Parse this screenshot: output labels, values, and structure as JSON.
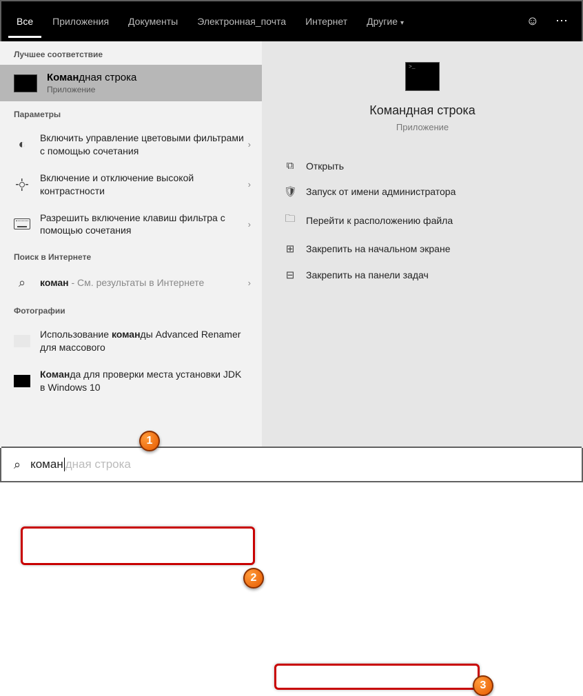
{
  "topbar": {
    "tabs": [
      "Все",
      "Приложения",
      "Документы",
      "Электронная_почта",
      "Интернет",
      "Другие"
    ],
    "active_index": 0
  },
  "sections": {
    "best_match": "Лучшее соответствие",
    "settings": "Параметры",
    "web": "Поиск в Интернете",
    "photos": "Фотографии"
  },
  "best": {
    "title_bold": "Коман",
    "title_rest": "дная строка",
    "subtitle": "Приложение"
  },
  "settings_items": [
    "Включить управление цветовыми фильтрами с помощью сочетания",
    "Включение и отключение высокой контрастности",
    "Разрешить включение клавиш фильтра с помощью сочетания"
  ],
  "web_item": {
    "query_bold": "коман",
    "suffix": " - См. результаты в Интернете"
  },
  "photo_items": [
    {
      "pre": "Использование ",
      "bold": "коман",
      "post": "ды Advanced Renamer для массового"
    },
    {
      "pre": "",
      "bold": "Коман",
      "post": "да для проверки места установки JDK в Windows 10"
    }
  ],
  "preview": {
    "title": "Командная строка",
    "subtitle": "Приложение"
  },
  "actions": {
    "open": "Открыть",
    "run_admin": "Запуск от имени администратора",
    "open_location": "Перейти к расположению файла",
    "pin_start": "Закрепить на начальном экране",
    "pin_taskbar": "Закрепить на панели задач"
  },
  "search": {
    "typed": "коман",
    "ghost": "дная строка"
  },
  "callouts": {
    "c1": "1",
    "c2": "2",
    "c3": "3"
  }
}
